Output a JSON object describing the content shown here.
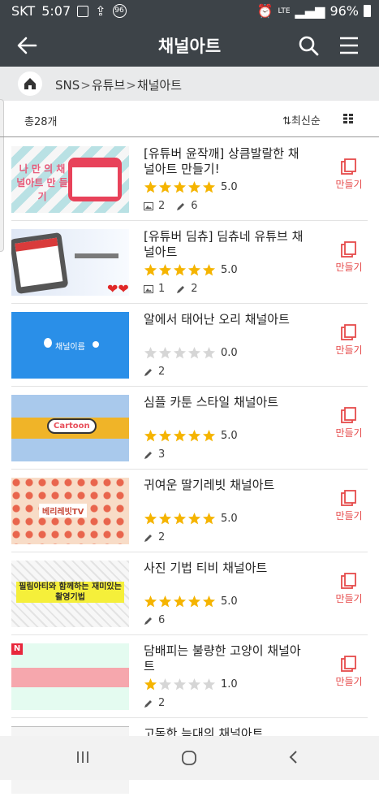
{
  "status": {
    "carrier": "SKT",
    "time": "5:07",
    "badge": "96",
    "network": "LTE",
    "battery": "96%"
  },
  "header": {
    "title": "채널아트"
  },
  "breadcrumb": {
    "items": [
      "SNS",
      "유튜브",
      "채널아트"
    ],
    "separator": ">"
  },
  "filter": {
    "count": "총28개",
    "sort": "최신순"
  },
  "make_label": "만들기",
  "items": [
    {
      "title": "[유튜버 윤작깨] 상큼발랄한 채널아트 만들기!",
      "rating": "5.0",
      "images": "2",
      "edits": "6",
      "thumb_text": "나 만 의 채널아트 만 들 기"
    },
    {
      "title": "[유튜버 딤츄] 딤츄네 유튜브 채널아트",
      "rating": "5.0",
      "images": "1",
      "edits": "2",
      "thumb_text": ""
    },
    {
      "title": "알에서 태어난 오리 채널아트",
      "rating": "0.0",
      "edits": "2",
      "thumb_text": "채널이름"
    },
    {
      "title": "심플 카툰 스타일 채널아트",
      "rating": "5.0",
      "edits": "3",
      "thumb_text": "Cartoon"
    },
    {
      "title": "귀여운 딸기레빗 채널아트",
      "rating": "5.0",
      "edits": "2",
      "thumb_text": "베리레빗TV"
    },
    {
      "title": "사진 기법 티비 채널아트",
      "rating": "5.0",
      "edits": "6",
      "thumb_text": "필림아티와 함께하는 재미있는촬영기법"
    },
    {
      "title": "담배피는 불량한 고양이 채널아트",
      "rating": "1.0",
      "edits": "2",
      "thumb_text": "",
      "badge": "N"
    },
    {
      "title": "고독한 늑대의 채널아트"
    }
  ]
}
